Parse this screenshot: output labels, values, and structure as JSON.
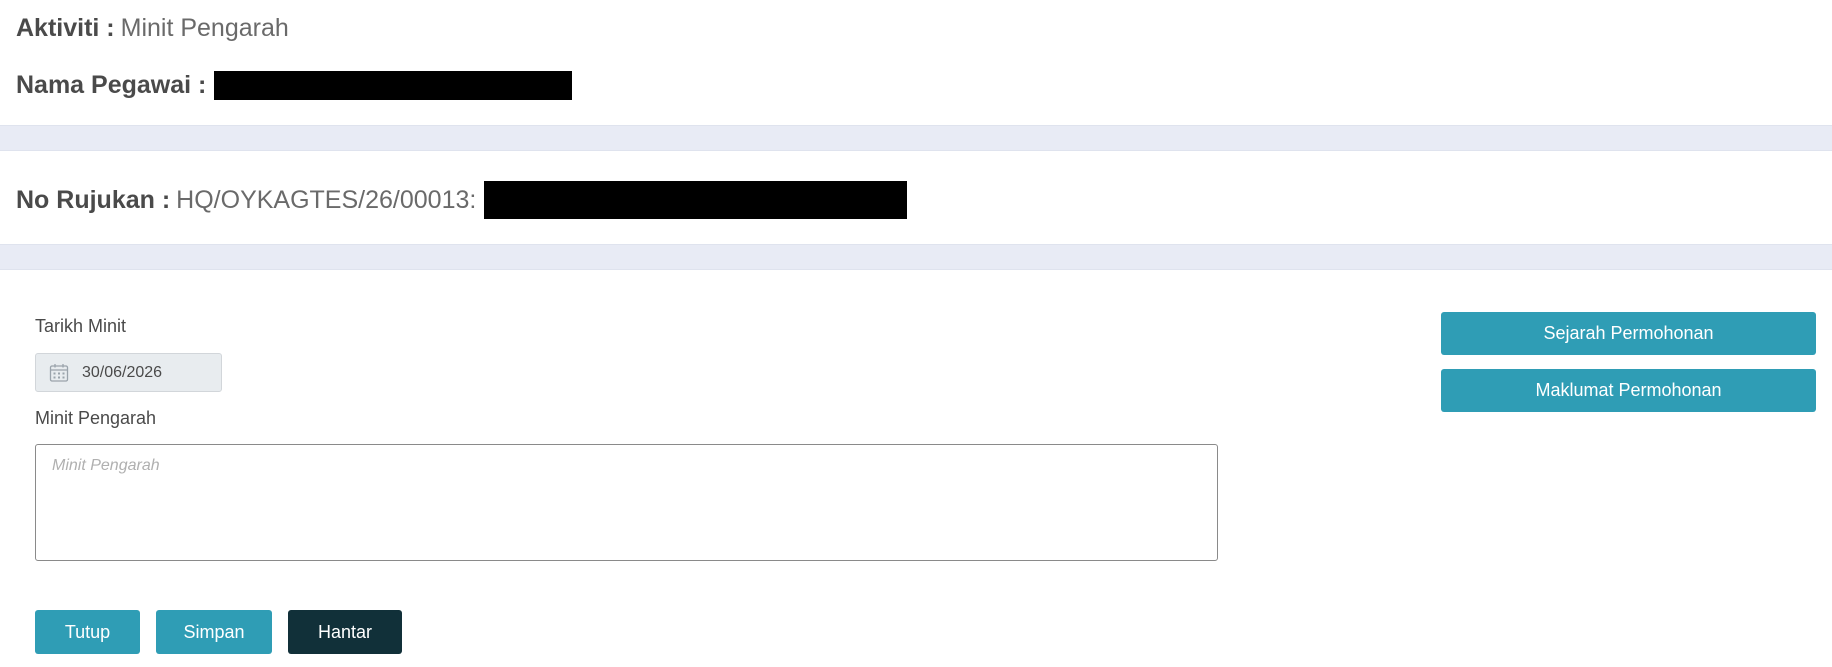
{
  "header": {
    "activity_label": "Aktiviti :",
    "activity_value": "Minit Pengarah",
    "employee_label": "Nama Pegawai :"
  },
  "reference": {
    "label": "No Rujukan :",
    "value": "HQ/OYKAGTES/26/00013:"
  },
  "form": {
    "date_label": "Tarikh Minit",
    "date_value": "30/06/2026",
    "minute_label": "Minit Pengarah",
    "minute_placeholder": "Minit Pengarah"
  },
  "side_buttons": {
    "history": "Sejarah Permohonan",
    "info": "Maklumat Permohonan"
  },
  "actions": {
    "close": "Tutup",
    "save": "Simpan",
    "send": "Hantar"
  },
  "colors": {
    "accent": "#2f9db5",
    "dark_button": "#113039",
    "band": "#e8ebf5",
    "redaction": "#000000"
  }
}
